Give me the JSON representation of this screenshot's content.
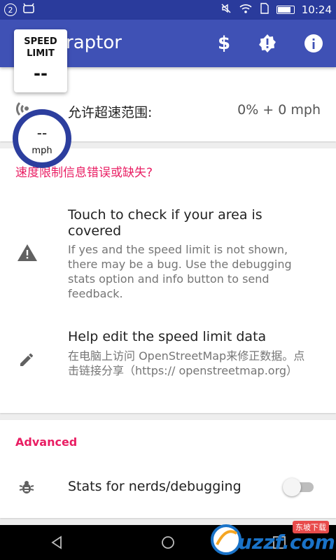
{
  "status_bar": {
    "notification_count": "2",
    "time": "10:24"
  },
  "app_bar": {
    "title": "raptor",
    "actions": [
      "dollar-icon",
      "alert-badge-icon",
      "info-icon"
    ]
  },
  "speed_limit_widget": {
    "label": "SPEED LIMIT",
    "value": "--"
  },
  "speedometer": {
    "value": "--",
    "unit": "mph"
  },
  "settings_card": {
    "tolerance_label": "允许超速范围:",
    "tolerance_value": "0% + 0 mph"
  },
  "help_card": {
    "header": "速度限制信息错误或缺失?",
    "items": [
      {
        "icon": "warning-icon",
        "title": "Touch to check if your area is covered",
        "subtitle": "If yes and the speed limit is not shown, there may be a bug. Use the debugging stats option and info button to send feedback."
      },
      {
        "icon": "pencil-icon",
        "title": "Help edit the speed limit data",
        "subtitle": "在电脑上访问 OpenStreetMap来修正数据。点击链接分享（https:// openstreetmap.org）"
      }
    ]
  },
  "advanced_card": {
    "header": "Advanced",
    "stats_label": "Stats for nerds/debugging",
    "stats_enabled": false
  },
  "watermark": {
    "brand": "uzzf.com",
    "tag": "东坡下载"
  },
  "colors": {
    "primary": "#3f51b5",
    "status_bar": "#2a3b9c",
    "accent": "#e91e63"
  }
}
